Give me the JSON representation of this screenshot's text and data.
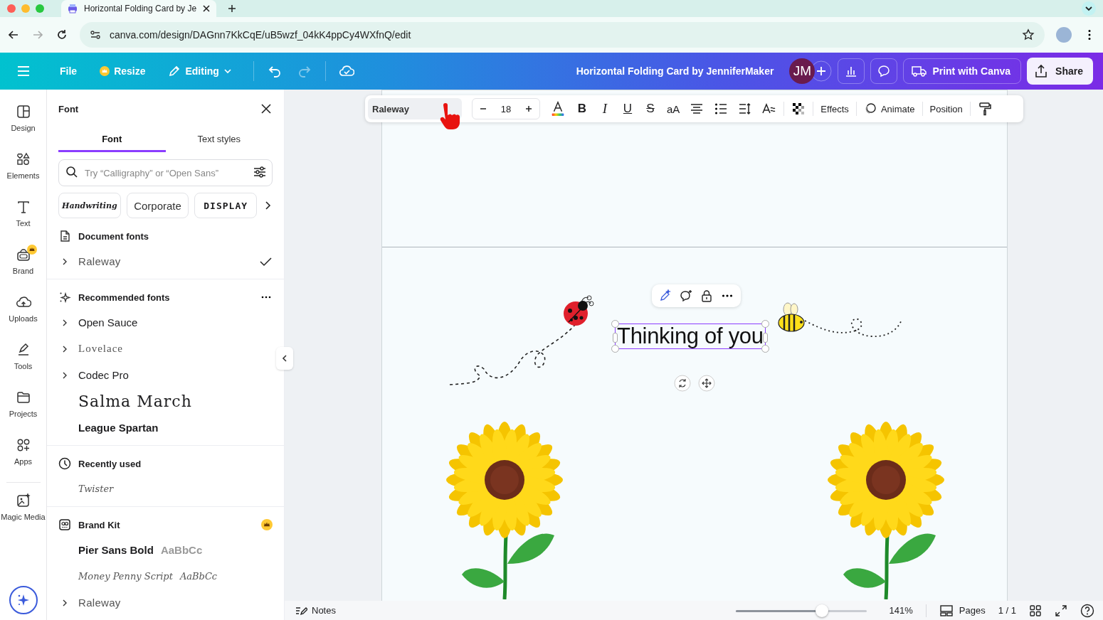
{
  "browser": {
    "tab_title": "Horizontal Folding Card by Je",
    "url": "canva.com/design/DAGnn7KkCqE/uB5wzf_04kK4ppCy4WXfnQ/edit"
  },
  "header": {
    "menu": [
      {
        "label": "File",
        "kind": "plain"
      },
      {
        "label": "Resize",
        "kind": "premium"
      },
      {
        "label": "Editing",
        "kind": "dropdown"
      }
    ],
    "title": "Horizontal Folding Card by JenniferMaker",
    "avatar": "JM",
    "print_button": "Print with Canva",
    "share_button": "Share"
  },
  "rail": [
    {
      "label": "Design",
      "kind": "design",
      "premium": false
    },
    {
      "label": "Elements",
      "kind": "elements",
      "premium": false
    },
    {
      "label": "Text",
      "kind": "text",
      "premium": false
    },
    {
      "label": "Brand",
      "kind": "brand",
      "premium": true
    },
    {
      "label": "Uploads",
      "kind": "uploads",
      "premium": false
    },
    {
      "label": "Tools",
      "kind": "tools",
      "premium": false
    },
    {
      "label": "Projects",
      "kind": "projects",
      "premium": false
    },
    {
      "label": "Apps",
      "kind": "apps",
      "premium": false
    },
    {
      "label": "Magic Media",
      "kind": "magic",
      "premium": false
    }
  ],
  "panel": {
    "title": "Font",
    "tabs": [
      {
        "label": "Font",
        "selected": true
      },
      {
        "label": "Text styles",
        "selected": false
      }
    ],
    "search": {
      "placeholder": "Try “Calligraphy” or “Open Sans”"
    },
    "categories": [
      {
        "label": "Handwriting",
        "kind": "script"
      },
      {
        "label": "Corporate",
        "kind": "sans"
      },
      {
        "label": "DISPLAY",
        "kind": "display"
      }
    ],
    "sections": [
      {
        "kind": "document",
        "heading": "Document fonts",
        "premium": false,
        "menu": false,
        "fonts": [
          {
            "name": "Raleway",
            "kind": "light",
            "expandable": true,
            "checked": true
          }
        ]
      },
      {
        "kind": "recommended",
        "heading": "Recommended fonts",
        "premium": false,
        "menu": true,
        "fonts": [
          {
            "name": "Open Sauce",
            "kind": "sans",
            "expandable": true,
            "checked": false
          },
          {
            "name": "Lovelace",
            "kind": "serif",
            "expandable": true,
            "checked": false
          },
          {
            "name": "Codec Pro",
            "kind": "sans",
            "expandable": true,
            "checked": false
          },
          {
            "name": "Salma March",
            "kind": "wide",
            "expandable": false,
            "checked": false
          },
          {
            "name": "League Spartan",
            "kind": "heavy",
            "expandable": false,
            "checked": false
          }
        ]
      },
      {
        "kind": "recent",
        "heading": "Recently used",
        "premium": false,
        "menu": false,
        "fonts": [
          {
            "name": "Twister",
            "kind": "script",
            "expandable": false,
            "checked": false
          }
        ]
      },
      {
        "kind": "brand",
        "heading": "Brand Kit",
        "premium": true,
        "menu": false,
        "fonts": [
          {
            "name": "Pier Sans Bold",
            "kind": "heavy",
            "expandable": false,
            "checked": false,
            "sample": "AaBbCc"
          },
          {
            "name": "Money Penny Script",
            "kind": "script",
            "expandable": false,
            "checked": false,
            "sample": "AaBbCc"
          },
          {
            "name": "Raleway",
            "kind": "light",
            "expandable": true,
            "checked": false
          }
        ]
      }
    ]
  },
  "toolbar": {
    "font": "Raleway",
    "size": "18",
    "format": [
      {
        "label": "B",
        "kind": "bold"
      },
      {
        "label": "I",
        "kind": "italic"
      },
      {
        "label": "U",
        "kind": "underline"
      },
      {
        "label": "S",
        "kind": "strike"
      },
      {
        "label": "aA",
        "kind": "case"
      }
    ],
    "effects": "Effects",
    "animate": "Animate",
    "position": "Position"
  },
  "canvas": {
    "text": "Thinking of you",
    "selected": true
  },
  "bottom": {
    "notes": "Notes",
    "zoom": {
      "level": 0.66
    },
    "zoom_label": "141%",
    "pages": "Pages",
    "page_count": "1 / 1"
  }
}
